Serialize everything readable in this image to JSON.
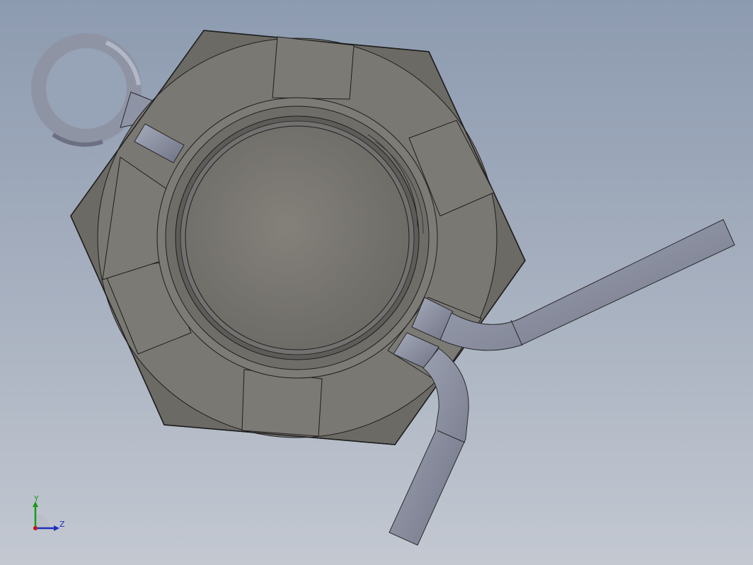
{
  "viewport": {
    "background_top": "#8d9bb0",
    "background_bottom": "#c3c8d1"
  },
  "model": {
    "parts": [
      "hex-nut",
      "cotter-pin"
    ],
    "nut_colors": {
      "face": "#7a7873",
      "chamfer": "#5f5d58",
      "edge": "#1e1e1e"
    },
    "pin_colors": {
      "body": "#9398a8",
      "shade": "#6f7385"
    }
  },
  "triad": {
    "y_label": "Y",
    "z_label": "Z",
    "y_color": "#1a9a1a",
    "z_color": "#1f2fbf",
    "x_color": "#c01818"
  }
}
